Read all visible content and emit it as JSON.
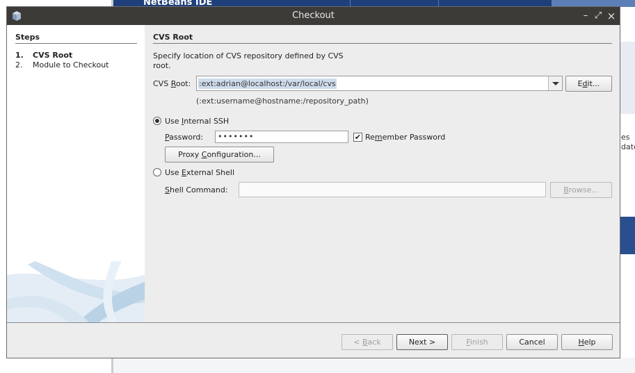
{
  "background": {
    "app_logo_text": "NetBeans IDE",
    "right_snippet_lines": [
      "es",
      "date"
    ]
  },
  "dialog": {
    "title": "Checkout",
    "controls": {
      "minimize": "–",
      "maximize": "⤢",
      "close": "×"
    },
    "steps": {
      "heading": "Steps",
      "items": [
        {
          "number": "1.",
          "label": "CVS Root",
          "active": true
        },
        {
          "number": "2.",
          "label": "Module to Checkout",
          "active": false
        }
      ]
    },
    "panel": {
      "heading": "CVS Root",
      "description": "Specify location of CVS repository defined by CVS root.",
      "cvs_root": {
        "label_prefix": "CVS ",
        "label_mnemonic": "R",
        "label_suffix": "oot:",
        "value": ":ext:adrian@localhost:/var/local/cvs",
        "hint": "(:ext:username@hostname:/repository_path)",
        "edit_button": {
          "pre": "E",
          "mn": "d",
          "post": "it..."
        }
      },
      "internal_ssh": {
        "label_pre": "Use ",
        "label_mn": "I",
        "label_post": "nternal SSH",
        "selected": true,
        "password_label_mn": "P",
        "password_label_post": "assword:",
        "password_value": "•••••••",
        "remember": {
          "pre": "Re",
          "mn": "m",
          "post": "ember Password",
          "checked": true
        },
        "proxy_button": {
          "pre": "Proxy ",
          "mn": "C",
          "post": "onfiguration..."
        }
      },
      "external_shell": {
        "label_pre": "Use ",
        "label_mn": "E",
        "label_post": "xternal Shell",
        "selected": false,
        "shell_label_mn": "S",
        "shell_label_post": "hell Command:",
        "shell_value": "",
        "browse_button": {
          "mn": "B",
          "post": "rowse..."
        }
      }
    },
    "footer": {
      "back": {
        "pre": "< ",
        "mn": "B",
        "post": "ack",
        "enabled": false
      },
      "next": {
        "label": "Next >",
        "enabled": true
      },
      "finish": {
        "mn": "F",
        "post": "inish",
        "enabled": false
      },
      "cancel": {
        "label": "Cancel",
        "enabled": true
      },
      "help": {
        "mn": "H",
        "post": "elp",
        "enabled": true
      }
    }
  }
}
